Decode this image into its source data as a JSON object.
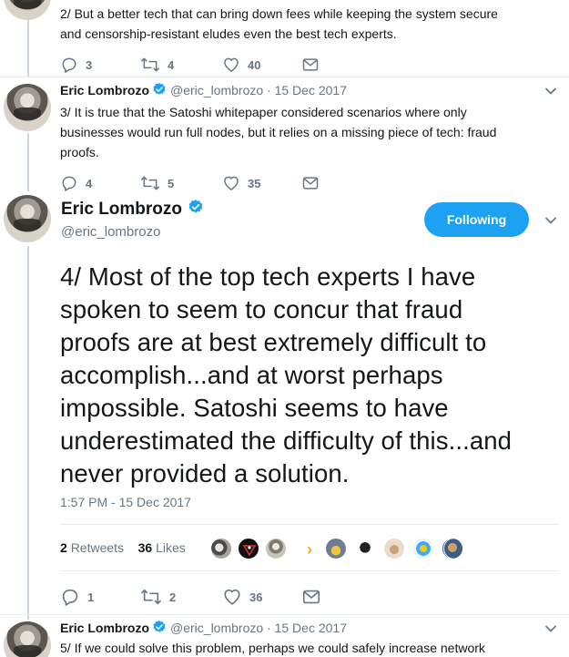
{
  "tweets": {
    "t2": {
      "text_line1": "2/ But a better tech that can bring down fees while keeping the system secure",
      "text_line2": "and censorship-resistant eludes even the best tech experts.",
      "replies": "3",
      "retweets": "4",
      "likes": "40"
    },
    "t3": {
      "name": "Eric Lombrozo",
      "handle_date": "@eric_lombrozo · 15 Dec 2017",
      "text_line1": "3/ It is true that the Satoshi whitepaper considered scenarios where only",
      "text_line2": "businesses would run full nodes, but it relies on a missing piece of tech: fraud",
      "text_line3": "proofs.",
      "replies": "4",
      "retweets": "5",
      "likes": "35"
    },
    "t4": {
      "name": "Eric Lombrozo",
      "handle": "@eric_lombrozo",
      "follow_label": "Following",
      "lines": [
        "4/ Most of the top tech experts I have",
        "spoken to seem to concur that fraud",
        "proofs are at best extremely difficult to",
        "accomplish...and at worst perhaps",
        "impossible. Satoshi seems to have",
        "underestimated the difficulty of this...and",
        "never provided a solution."
      ],
      "timestamp": "1:57 PM - 15 Dec 2017",
      "retweet_count": "2",
      "retweet_label": "Retweets",
      "like_count": "36",
      "like_label": "Likes",
      "replies": "1",
      "retweets": "2",
      "likes": "36"
    },
    "t5": {
      "name": "Eric Lombrozo",
      "handle_date": "@eric_lombrozo · 15 Dec 2017",
      "text_line1": "5/ If we could solve this problem, perhaps we could safely increase network"
    }
  },
  "colors": {
    "accent": "#1da1f2",
    "muted": "#657786",
    "text": "#14171a",
    "divider": "#e6ecf0"
  },
  "icons": [
    "reply-icon",
    "retweet-icon",
    "like-icon",
    "message-icon",
    "verified-icon",
    "chevron-down-icon"
  ]
}
